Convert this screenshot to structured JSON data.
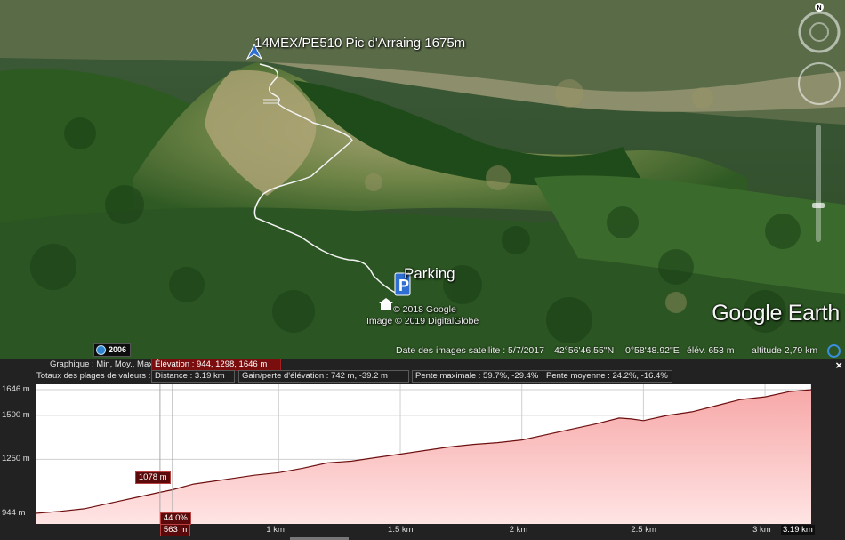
{
  "map": {
    "summit_label": "14MEX/PE510 Pic d'Arraing 1675m",
    "parking_label": "Parking",
    "copyright_line1": "© 2018 Google",
    "copyright_line2": "Image © 2019 DigitalGlobe",
    "brand_google": "Google",
    "brand_earth": " Earth",
    "historical_year": "2006",
    "compass_north": "N",
    "status": {
      "image_date": "Date des images satellite : 5/7/2017",
      "latitude": "42°56'46.55\"N",
      "longitude": "0°58'48.92\"E",
      "elevation": "élév.  653 m",
      "eye_altitude": "altitude   2,79 km"
    },
    "colors": {
      "track": "#f2f2f2",
      "placemark": "#2f6fd1"
    }
  },
  "profile": {
    "close": "×",
    "graph_label": "Graphique : Min, Moy., Max",
    "elevation_summary": "Élévation : 944, 1298, 1646 m",
    "totals_label": "Totaux des plages de valeurs :",
    "distance": "Distance : 3.19 km",
    "gain_loss": "Gain/perte d'élévation : 742 m, -39.2 m",
    "max_slope": "Pente maximale : 59.7%, -29.4%",
    "avg_slope": "Pente moyenne : 24.2%, -16.4%",
    "cursor_elevation": "1078 m",
    "cursor_slope": "44.0%",
    "cursor_distance": "563 m"
  },
  "chart_data": {
    "type": "area",
    "x_unit": "km",
    "y_unit": "m",
    "ylim": [
      944,
      1646
    ],
    "xlim": [
      0,
      3.19
    ],
    "y_tick_labels": [
      "1646 m",
      "1500 m",
      "1250 m",
      "944 m"
    ],
    "y_ticks": [
      1646,
      1500,
      1250,
      944
    ],
    "x_tick_labels": [
      "1 km",
      "1.5 km",
      "2 km",
      "2.5 km",
      "3 km",
      "3.19 km"
    ],
    "x_ticks": [
      1,
      1.5,
      2,
      2.5,
      3,
      3.19
    ],
    "cursor_x": 0.563,
    "x": [
      0,
      0.1,
      0.2,
      0.3,
      0.4,
      0.5,
      0.563,
      0.65,
      0.8,
      0.9,
      1.0,
      1.1,
      1.2,
      1.3,
      1.4,
      1.5,
      1.6,
      1.7,
      1.8,
      1.9,
      2.0,
      2.1,
      2.2,
      2.3,
      2.4,
      2.45,
      2.5,
      2.6,
      2.7,
      2.8,
      2.9,
      3.0,
      3.1,
      3.19
    ],
    "y": [
      944,
      955,
      970,
      1000,
      1030,
      1060,
      1078,
      1110,
      1140,
      1160,
      1175,
      1200,
      1230,
      1240,
      1260,
      1280,
      1300,
      1320,
      1335,
      1345,
      1360,
      1390,
      1420,
      1450,
      1485,
      1480,
      1470,
      1500,
      1520,
      1555,
      1590,
      1605,
      1635,
      1646
    ],
    "colors": {
      "line": "#6e0f0f",
      "fill_top": "#f7a8a8",
      "fill_bottom": "#ffe4e4",
      "grid": "#cfcfcf"
    }
  }
}
